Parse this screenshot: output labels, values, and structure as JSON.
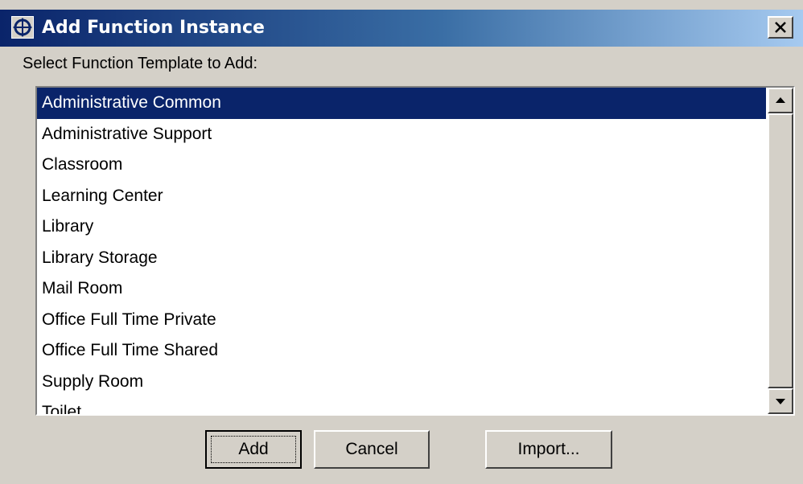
{
  "window": {
    "title": "Add Function Instance",
    "icon": "move-crosshair-icon",
    "close_icon": "close-x-icon"
  },
  "prompt_label": "Select Function Template to Add:",
  "templates": {
    "selected_index": 0,
    "items": [
      "Administrative Common",
      "Administrative Support",
      "Classroom",
      "Learning Center",
      "Library",
      "Library Storage",
      "Mail Room",
      "Office Full Time Private",
      "Office Full Time Shared",
      "Supply Room",
      "Toilet"
    ]
  },
  "buttons": {
    "add": "Add",
    "cancel": "Cancel",
    "import": "Import..."
  },
  "colors": {
    "selection": "#0a246a",
    "title_gradient_start": "#0a246a",
    "title_gradient_end": "#a6caf0",
    "face": "#d4d0c8"
  }
}
